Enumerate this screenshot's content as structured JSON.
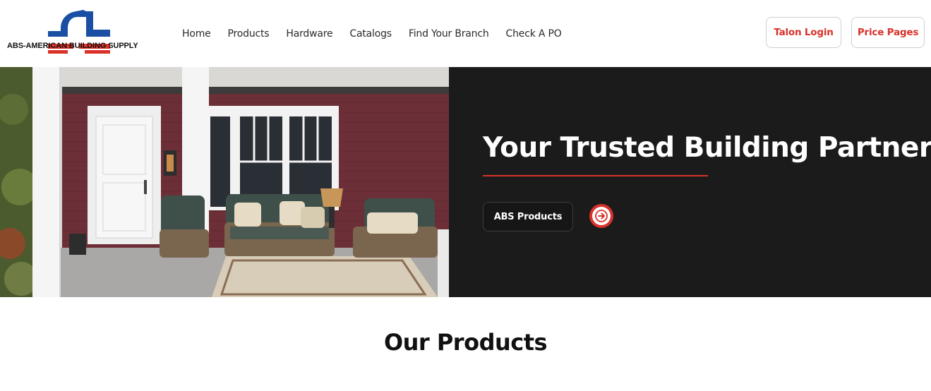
{
  "brand": {
    "logo_text": "ABS-AMERICAN BUILDING SUPPLY",
    "logo_mark": "®",
    "colors": {
      "blue": "#1a4fa3",
      "red": "#d9322b",
      "black": "#111111"
    }
  },
  "nav": {
    "items": [
      {
        "label": "Home"
      },
      {
        "label": "Products"
      },
      {
        "label": "Hardware"
      },
      {
        "label": "Catalogs"
      },
      {
        "label": "Find Your Branch"
      },
      {
        "label": "Check A PO"
      }
    ]
  },
  "header_buttons": {
    "talon_login": "Talon Login",
    "price_pages": "Price Pages"
  },
  "hero": {
    "title": "Your Trusted Building Partner",
    "cta_label": "ABS Products",
    "arrow_icon": "arrow-right-circle-icon",
    "accent_color": "#d9322b",
    "panel_color": "#1b1b1b"
  },
  "products_section": {
    "title": "Our Products"
  }
}
